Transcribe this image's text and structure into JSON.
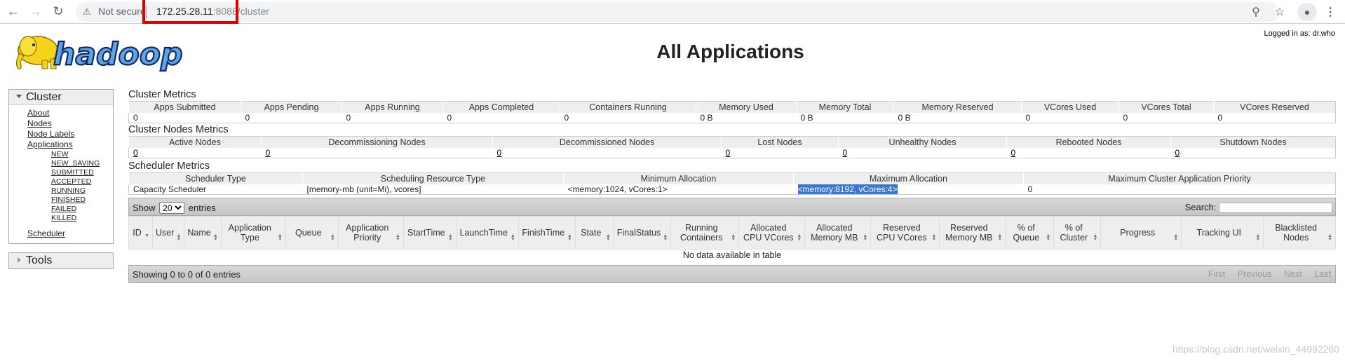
{
  "browser": {
    "security_label": "Not secure",
    "url_host": "172.25.28.11",
    "url_port": ":8088",
    "url_path": "/cluster"
  },
  "header": {
    "logged_in": "Logged in as: dr.who",
    "title": "All Applications"
  },
  "nav": {
    "cluster_label": "Cluster",
    "links": [
      "About",
      "Nodes",
      "Node Labels",
      "Applications"
    ],
    "app_states": [
      "NEW",
      "NEW_SAVING",
      "SUBMITTED",
      "ACCEPTED",
      "RUNNING",
      "FINISHED",
      "FAILED",
      "KILLED"
    ],
    "scheduler": "Scheduler",
    "tools_label": "Tools"
  },
  "cluster_metrics": {
    "title": "Cluster Metrics",
    "headers": [
      "Apps Submitted",
      "Apps Pending",
      "Apps Running",
      "Apps Completed",
      "Containers Running",
      "Memory Used",
      "Memory Total",
      "Memory Reserved",
      "VCores Used",
      "VCores Total",
      "VCores Reserved"
    ],
    "values": [
      "0",
      "0",
      "0",
      "0",
      "0",
      "0 B",
      "0 B",
      "0 B",
      "0",
      "0",
      "0"
    ]
  },
  "node_metrics": {
    "title": "Cluster Nodes Metrics",
    "headers": [
      "Active Nodes",
      "Decommissioning Nodes",
      "Decommissioned Nodes",
      "Lost Nodes",
      "Unhealthy Nodes",
      "Rebooted Nodes",
      "Shutdown Nodes"
    ],
    "values": [
      "0",
      "0",
      "0",
      "0",
      "0",
      "0",
      "0"
    ]
  },
  "scheduler_metrics": {
    "title": "Scheduler Metrics",
    "headers": [
      "Scheduler Type",
      "Scheduling Resource Type",
      "Minimum Allocation",
      "Maximum Allocation",
      "Maximum Cluster Application Priority"
    ],
    "values": [
      "Capacity Scheduler",
      "[memory-mb (unit=Mi), vcores]",
      "<memory:1024, vCores:1>",
      "<memory:8192, vCores:4>",
      "0"
    ]
  },
  "apps_table": {
    "show_label": "Show",
    "page_size": "20",
    "entries_label": "entries",
    "search_label": "Search:",
    "headers": [
      "ID",
      "User",
      "Name",
      "Application Type",
      "Queue",
      "Application Priority",
      "StartTime",
      "LaunchTime",
      "FinishTime",
      "State",
      "FinalStatus",
      "Running Containers",
      "Allocated CPU VCores",
      "Allocated Memory MB",
      "Reserved CPU VCores",
      "Reserved Memory MB",
      "% of Queue",
      "% of Cluster",
      "Progress",
      "Tracking UI",
      "Blacklisted Nodes"
    ],
    "empty_message": "No data available in table",
    "info": "Showing 0 to 0 of 0 entries",
    "pager": [
      "First",
      "Previous",
      "Next",
      "Last"
    ]
  },
  "watermark": "https://blog.csdn.net/weixin_44992260"
}
